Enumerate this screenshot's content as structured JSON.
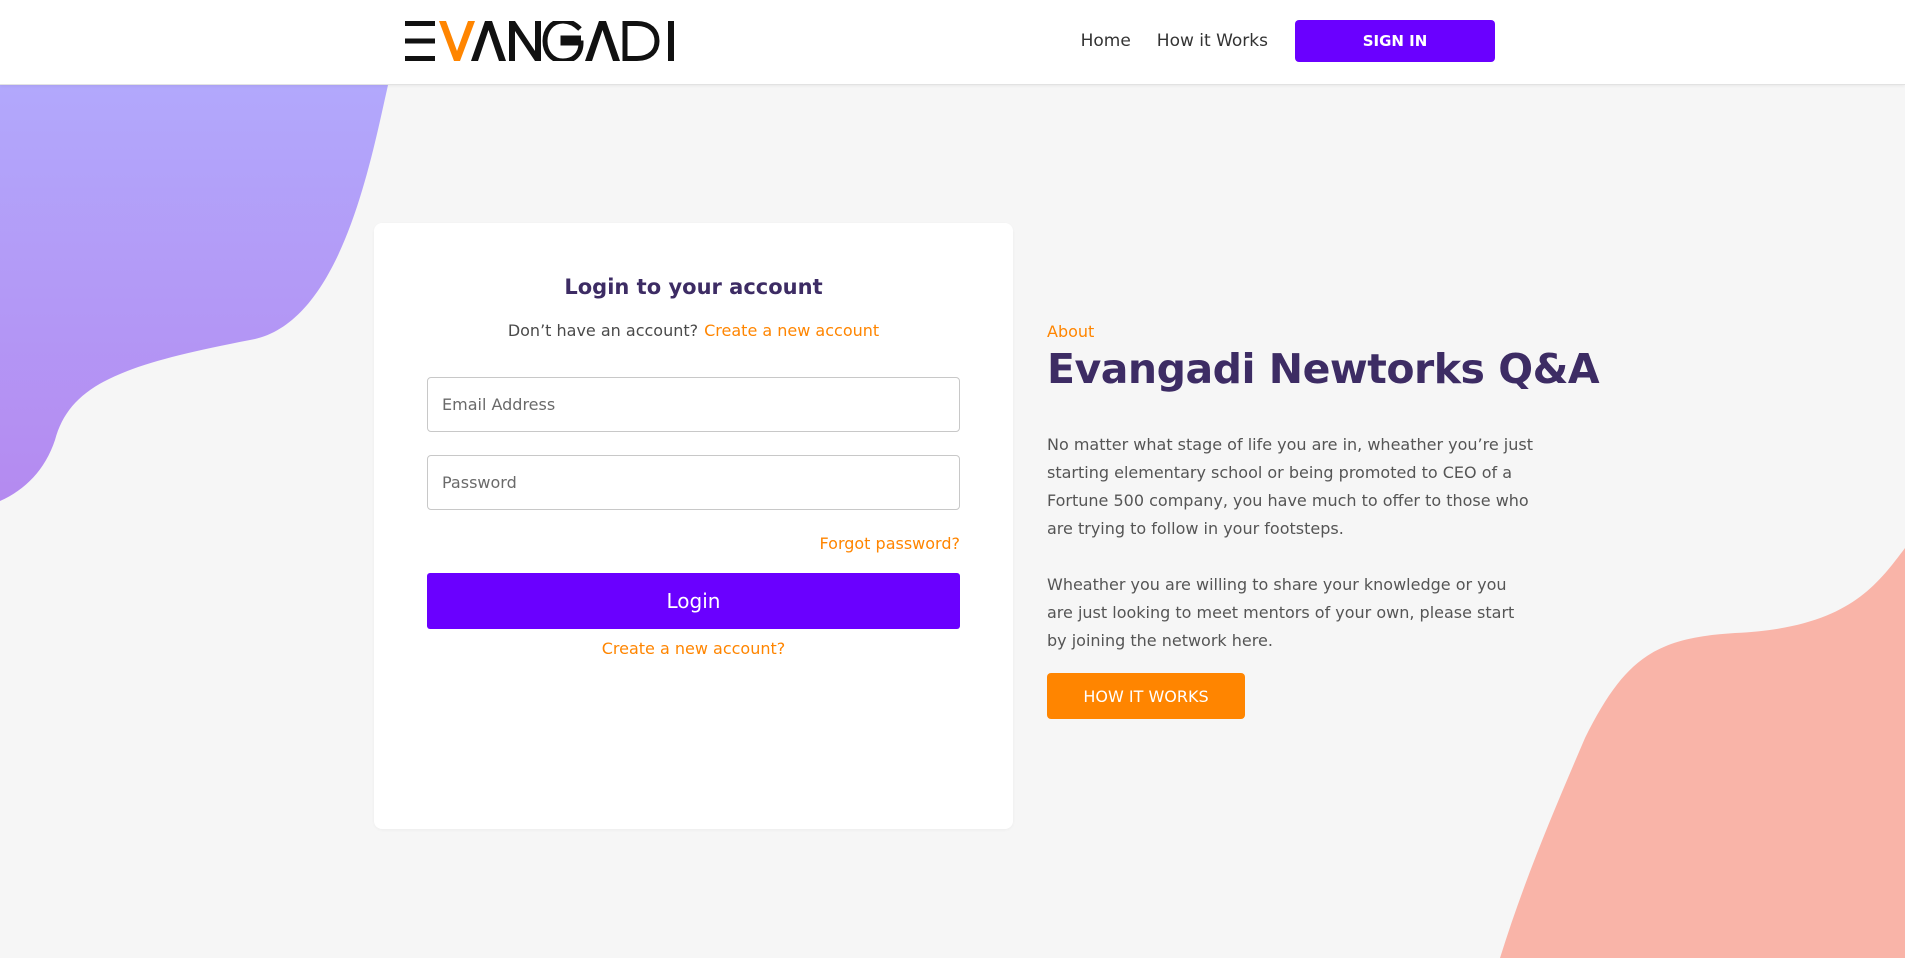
{
  "header": {
    "logo_text": "EVANGADI",
    "nav": {
      "home": "Home",
      "how_it_works": "How it Works",
      "sign_in": "SIGN IN"
    }
  },
  "login": {
    "title": "Login to your account",
    "no_account_text": "Don’t have an account?",
    "create_new_link": "Create a new account",
    "email_placeholder": "Email Address",
    "password_placeholder": "Password",
    "forgot_password": "Forgot password?",
    "login_button": "Login",
    "create_new_bottom": "Create a new account?"
  },
  "about": {
    "label": "About",
    "title": "Evangadi Newtorks Q&A",
    "paragraph1": "No matter what stage of life you are in, wheather you’re just starting elementary school or being promoted to CEO of a Fortune 500 company, you have much to offer to those who are trying to follow in your footsteps.",
    "paragraph2": "Wheather you are willing to share your knowledge or you are just looking to meet mentors of your own, please start by joining the network here.",
    "button": "HOW IT WORKS"
  },
  "colors": {
    "primary": "#6a00ff",
    "accent": "#ff8500",
    "heading": "#3d2c64",
    "blob_left": "#b4a8fc",
    "blob_right": "#f9b4a8"
  }
}
